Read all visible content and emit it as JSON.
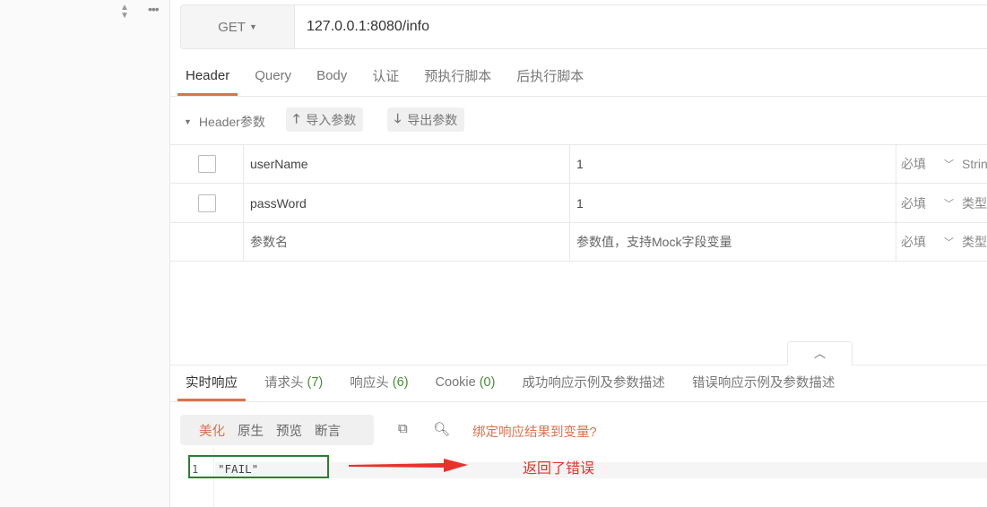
{
  "sidebar": {
    "sort_icon": "sort-icon",
    "more_icon": "ellipsis-icon"
  },
  "request": {
    "method": "GET",
    "url": "127.0.0.1:8080/info"
  },
  "tabs": [
    "Header",
    "Query",
    "Body",
    "认证",
    "预执行脚本",
    "后执行脚本"
  ],
  "header_section": {
    "title": "Header参数",
    "import_label": "导入参数",
    "export_label": "导出参数"
  },
  "params": [
    {
      "name": "userName",
      "value": "1",
      "required": "必填",
      "type": "String",
      "checked": false
    },
    {
      "name": "passWord",
      "value": "1",
      "required": "必填",
      "type": "类型",
      "checked": false
    }
  ],
  "new_param": {
    "name_placeholder": "参数名",
    "value_placeholder": "参数值，支持Mock字段变量",
    "required": "必填",
    "type": "类型"
  },
  "response_tabs": [
    {
      "label": "实时响应"
    },
    {
      "label": "请求头",
      "count": "(7)"
    },
    {
      "label": "响应头",
      "count": "(6)"
    },
    {
      "label": "Cookie",
      "count": "(0)"
    },
    {
      "label": "成功响应示例及参数描述"
    },
    {
      "label": "错误响应示例及参数描述"
    }
  ],
  "view_modes": [
    "美化",
    "原生",
    "预览",
    "断言"
  ],
  "bind_link": "绑定响应结果到变量?",
  "code": {
    "line_number": "1",
    "content": "\"FAIL\""
  },
  "annotation": "返回了错误",
  "colors": {
    "accent": "#d9734e",
    "annotation": "#e8322c",
    "highlight_box": "#2e7d32"
  }
}
